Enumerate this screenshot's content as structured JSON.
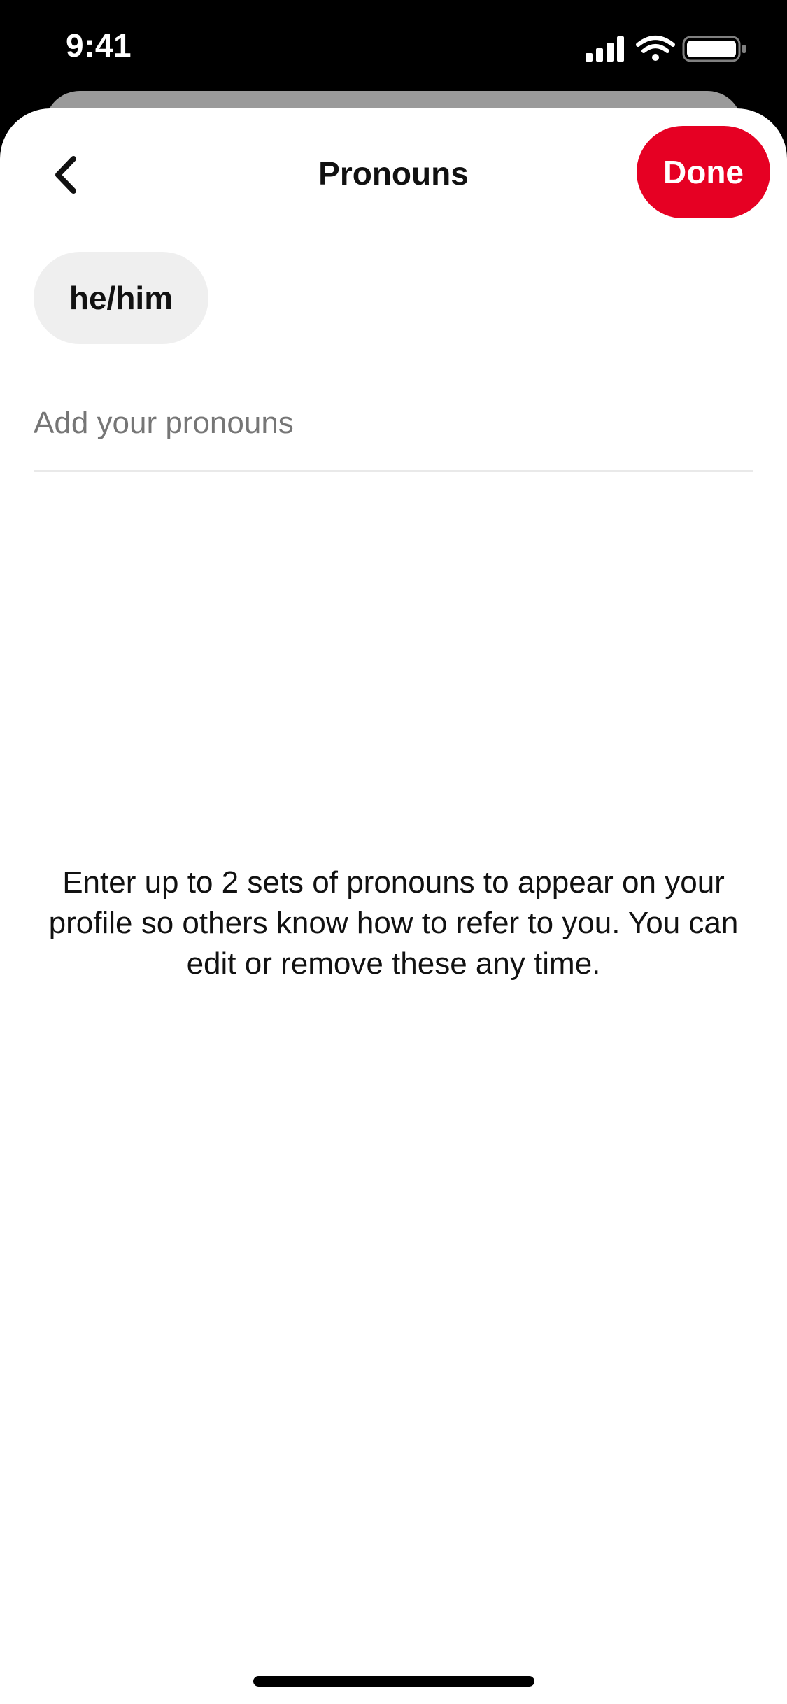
{
  "status_bar": {
    "time": "9:41",
    "icons": [
      "signal-icon",
      "wifi-icon",
      "battery-icon"
    ]
  },
  "header": {
    "back_icon": "chevron-left-icon",
    "title": "Pronouns",
    "done_label": "Done"
  },
  "pronouns": {
    "selected": [
      "he/him"
    ],
    "input_placeholder": "Add your pronouns",
    "input_value": ""
  },
  "help_text": "Enter up to 2 sets of pronouns to appear on your profile so others know how to refer to you. You can edit or remove these any time.",
  "colors": {
    "accent": "#e60023",
    "chip_background": "#efefef",
    "text": "#111111",
    "placeholder": "#767676"
  }
}
